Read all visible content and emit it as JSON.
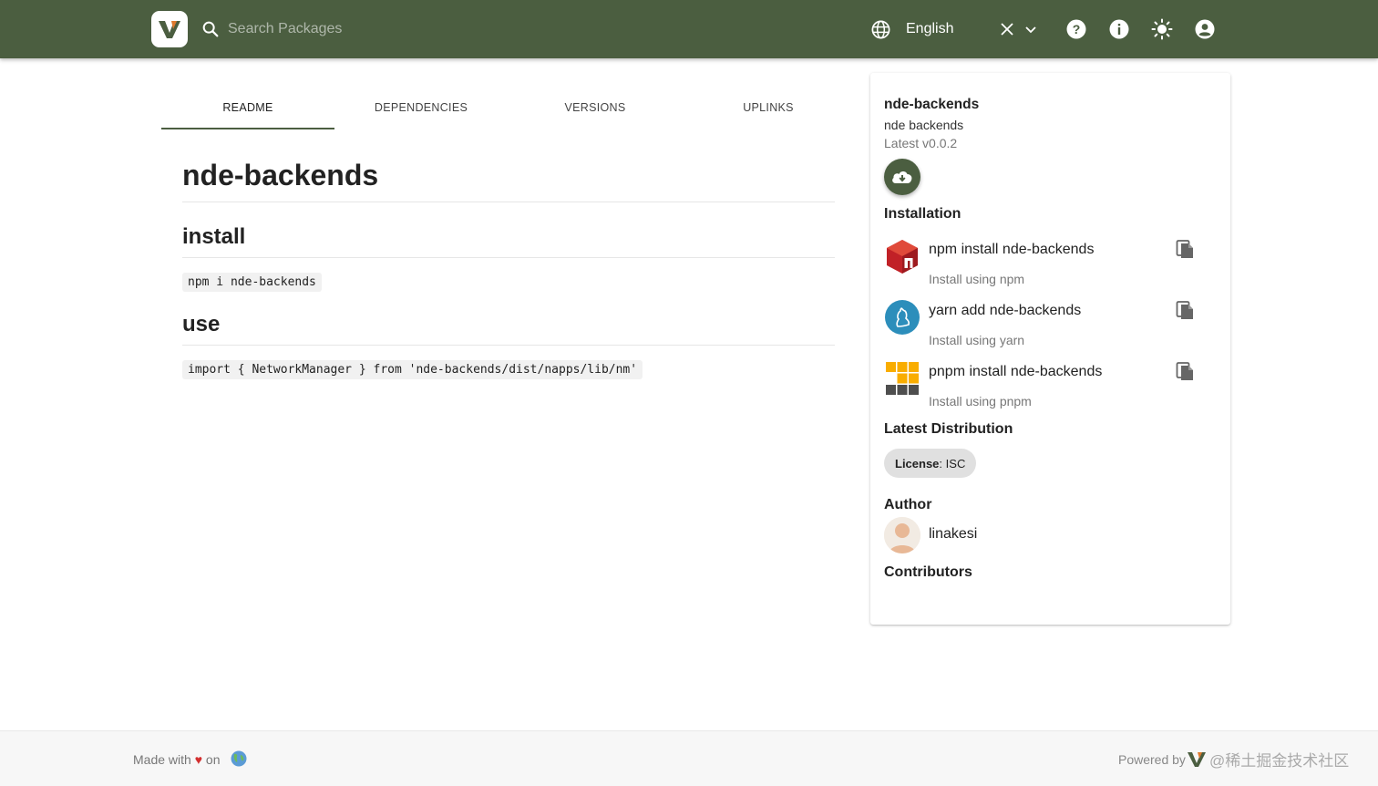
{
  "header": {
    "logo_letter": "V",
    "search_placeholder": "Search Packages",
    "language": "English",
    "bg_color": "#4b5e40",
    "icons": [
      "search-icon",
      "globe-icon",
      "close-icon",
      "chevron-down-icon",
      "help-icon",
      "info-icon",
      "light-mode-icon",
      "account-icon"
    ]
  },
  "tabs": [
    {
      "label": "README",
      "active": true
    },
    {
      "label": "DEPENDENCIES",
      "active": false
    },
    {
      "label": "VERSIONS",
      "active": false
    },
    {
      "label": "UPLINKS",
      "active": false
    }
  ],
  "readme": {
    "title": "nde-backends",
    "install_heading": "install",
    "install_code": "npm i nde-backends",
    "use_heading": "use",
    "use_code": "import { NetworkManager } from 'nde-backends/dist/napps/lib/nm'"
  },
  "sidebar": {
    "package_name": "nde-backends",
    "description": "nde backends",
    "latest": "Latest v0.0.2",
    "installation_title": "Installation",
    "install_items": [
      {
        "command": "npm install nde-backends",
        "subtitle": "Install using npm",
        "icon": "npm-icon"
      },
      {
        "command": "yarn add nde-backends",
        "subtitle": "Install using yarn",
        "icon": "yarn-icon"
      },
      {
        "command": "pnpm install nde-backends",
        "subtitle": "Install using pnpm",
        "icon": "pnpm-icon"
      }
    ],
    "latest_distribution_title": "Latest Distribution",
    "license_label": "License",
    "license_value": "ISC",
    "author_title": "Author",
    "author_name": "linakesi",
    "contributors_title": "Contributors"
  },
  "footer": {
    "made_with": "Made with",
    "heart": "♥",
    "on": "on",
    "powered_by": "Powered by",
    "watermark": "@稀土掘金技术社区"
  }
}
